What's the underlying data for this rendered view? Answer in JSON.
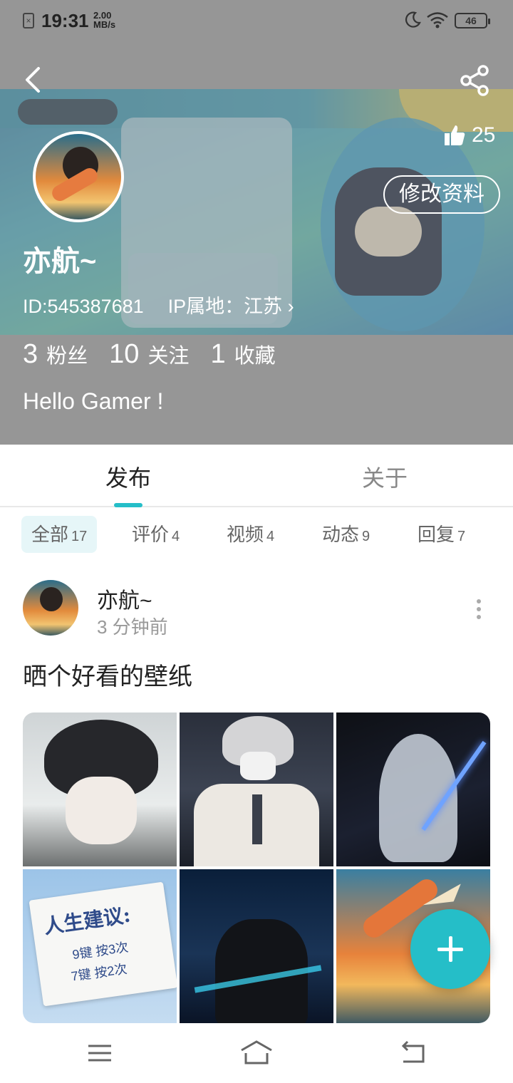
{
  "status_bar": {
    "time": "19:31",
    "speed_value": "2.00",
    "speed_unit": "MB/s",
    "battery": "46"
  },
  "profile": {
    "likes": "25",
    "edit_label": "修改资料",
    "nickname": "亦航~",
    "id_text": "ID:545387681",
    "ip_text": "IP属地：江苏 ›",
    "stats": [
      {
        "num": "3",
        "label": "粉丝"
      },
      {
        "num": "10",
        "label": "关注"
      },
      {
        "num": "1",
        "label": "收藏"
      }
    ],
    "bio": "Hello Gamer !"
  },
  "tabs": {
    "publish": "发布",
    "about": "关于"
  },
  "filters": [
    {
      "label": "全部",
      "count": "17"
    },
    {
      "label": "评价",
      "count": "4"
    },
    {
      "label": "视频",
      "count": "4"
    },
    {
      "label": "动态",
      "count": "9"
    },
    {
      "label": "回复",
      "count": "7"
    }
  ],
  "post": {
    "author": "亦航~",
    "time": "3 分钟前",
    "title": "晒个好看的壁纸",
    "image_note_line1": "人生建议:",
    "image_note_line2": "9键 按3次",
    "image_note_line3": "7键 按2次"
  },
  "colors": {
    "accent": "#25bec8",
    "chip_active_bg": "#e6f6f8"
  },
  "icons": [
    "sim-icon",
    "moon-icon",
    "wifi-icon",
    "battery-icon",
    "back-icon",
    "share-icon",
    "thumbs-up-icon",
    "more-icon",
    "plus-icon",
    "menu-icon",
    "home-icon",
    "return-icon"
  ]
}
